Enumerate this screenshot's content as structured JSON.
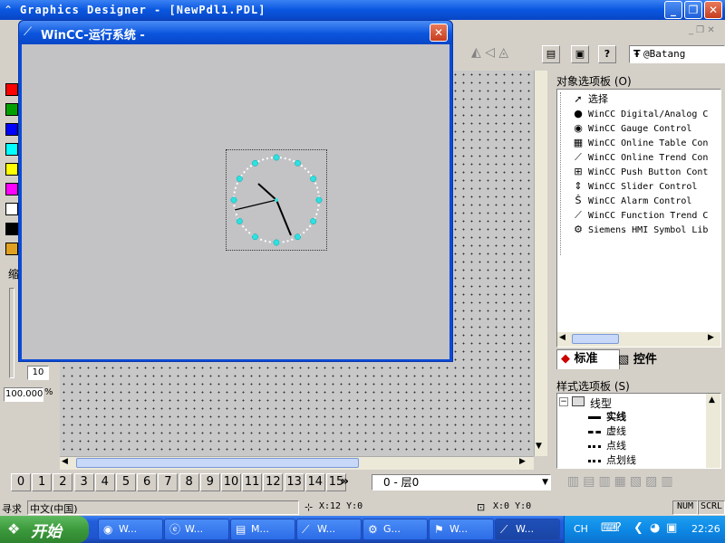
{
  "app": {
    "title": "Graphics Designer - [NewPdl1.PDL]"
  },
  "wincc_window": {
    "title": "WinCC-运行系统 -"
  },
  "toolbar": {
    "font_name": "@Batang"
  },
  "object_palette": {
    "title": "对象选项板 (O)",
    "items": [
      {
        "label": "选择",
        "icon": "pointer-icon"
      },
      {
        "label": "WinCC Digital/Analog C",
        "icon": "digital-analog-icon"
      },
      {
        "label": "WinCC Gauge Control",
        "icon": "gauge-icon"
      },
      {
        "label": "WinCC Online Table Con",
        "icon": "table-icon"
      },
      {
        "label": "WinCC Online Trend Con",
        "icon": "trend-icon"
      },
      {
        "label": "WinCC Push Button Cont",
        "icon": "push-button-icon"
      },
      {
        "label": "WinCC Slider Control",
        "icon": "slider-icon"
      },
      {
        "label": "WinCC Alarm Control",
        "icon": "alarm-icon"
      },
      {
        "label": "WinCC Function Trend C",
        "icon": "function-trend-icon"
      },
      {
        "label": "Siemens HMI Symbol Lib",
        "icon": "symbol-lib-icon"
      }
    ],
    "tabs": [
      "标准",
      "控件"
    ]
  },
  "style_palette": {
    "title": "样式选项板 (S)",
    "group": "线型",
    "items": [
      "实线",
      "虚线",
      "点线",
      "点划线"
    ]
  },
  "left_palette": {
    "zoom_label": "缩",
    "zoom_step": "10",
    "zoom_value": "100.000",
    "zoom_unit": "%",
    "colors": [
      "#ff0000",
      "#00a000",
      "#0000ff",
      "#00ffff",
      "#ffff00",
      "#ff00ff",
      "#ffffff",
      "#000000"
    ]
  },
  "layers": {
    "buttons": [
      "0",
      "1",
      "2",
      "3",
      "4",
      "5",
      "6",
      "7",
      "8",
      "9",
      "10",
      "11",
      "12",
      "13",
      "14",
      "15"
    ],
    "more": "»",
    "selected": "0 - 层0"
  },
  "status": {
    "field1": "寻求",
    "lang": "中文(中国)",
    "pos": "X:12 Y:0",
    "size": "X:0 Y:0",
    "num": "NUM",
    "scrl": "SCRL"
  },
  "taskbar": {
    "start": "开始",
    "tasks": [
      "W...",
      "W...",
      "M...",
      "W...",
      "G...",
      "W...",
      "W..."
    ],
    "lang": "CH",
    "time": "22:26"
  }
}
